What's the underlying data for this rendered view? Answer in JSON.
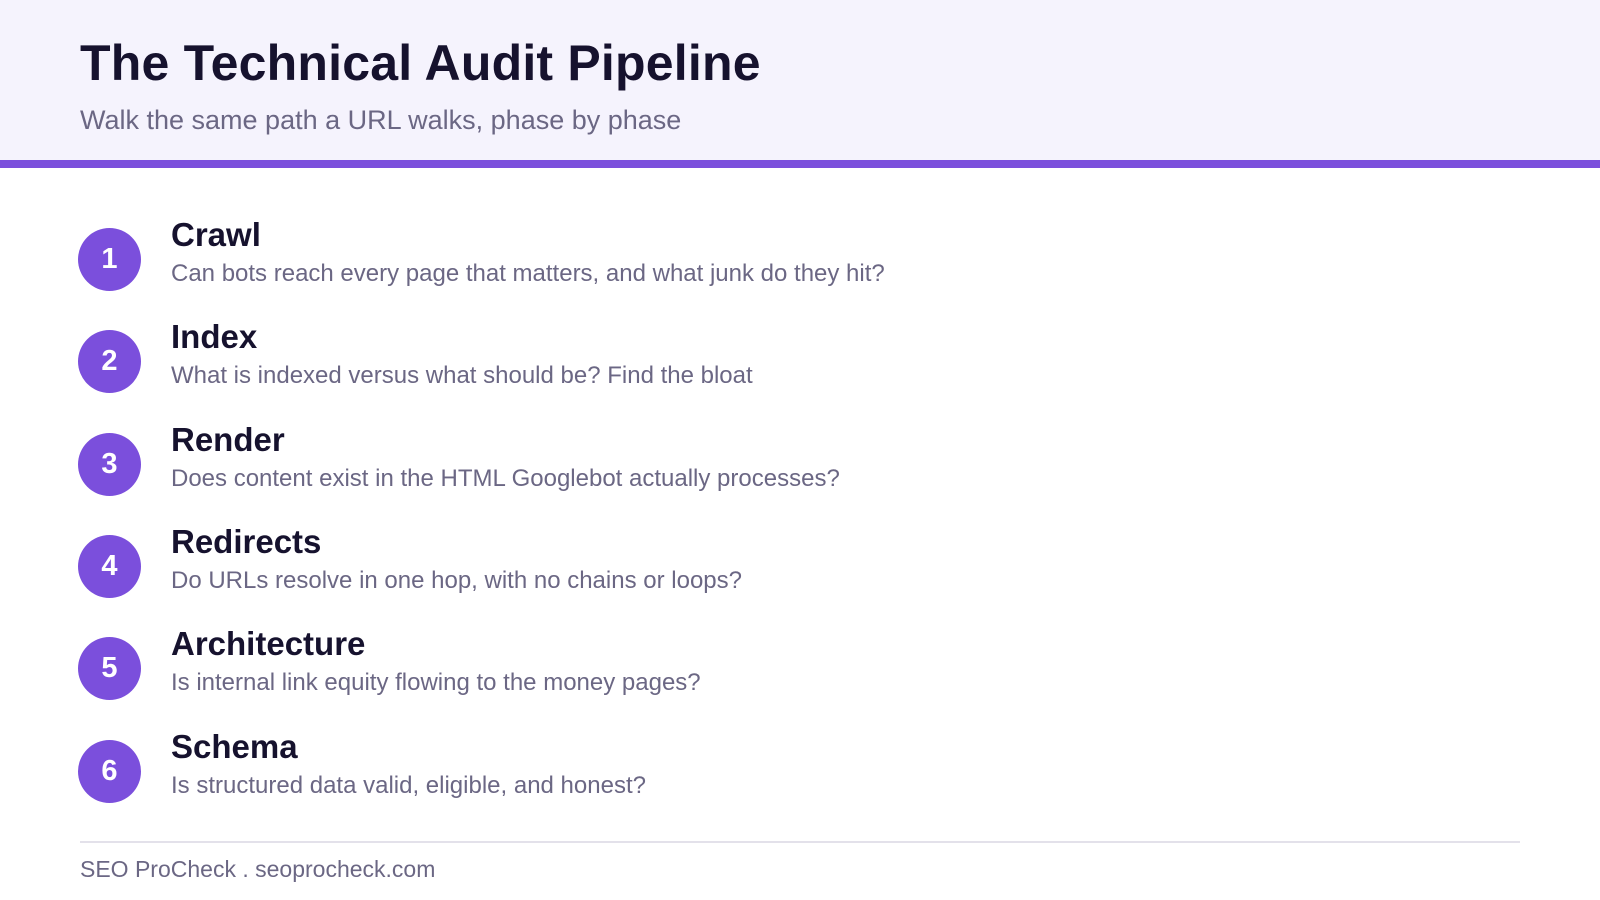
{
  "header": {
    "title": "The Technical Audit Pipeline",
    "subtitle": "Walk the same path a URL walks, phase by phase"
  },
  "steps": [
    {
      "number": "1",
      "title": "Crawl",
      "description": "Can bots reach every page that matters, and what junk do they hit?"
    },
    {
      "number": "2",
      "title": "Index",
      "description": "What is indexed versus what should be? Find the bloat"
    },
    {
      "number": "3",
      "title": "Render",
      "description": "Does content exist in the HTML Googlebot actually processes?"
    },
    {
      "number": "4",
      "title": "Redirects",
      "description": "Do URLs resolve in one hop, with no chains or loops?"
    },
    {
      "number": "5",
      "title": "Architecture",
      "description": "Is internal link equity flowing to the money pages?"
    },
    {
      "number": "6",
      "title": "Schema",
      "description": "Is structured data valid, eligible, and honest?"
    }
  ],
  "footer": {
    "text": "SEO ProCheck . seoprocheck.com"
  },
  "colors": {
    "accent": "#7b4fdc",
    "header_background": "#f5f3fd",
    "title": "#16122e",
    "muted_text": "#6b6784"
  }
}
